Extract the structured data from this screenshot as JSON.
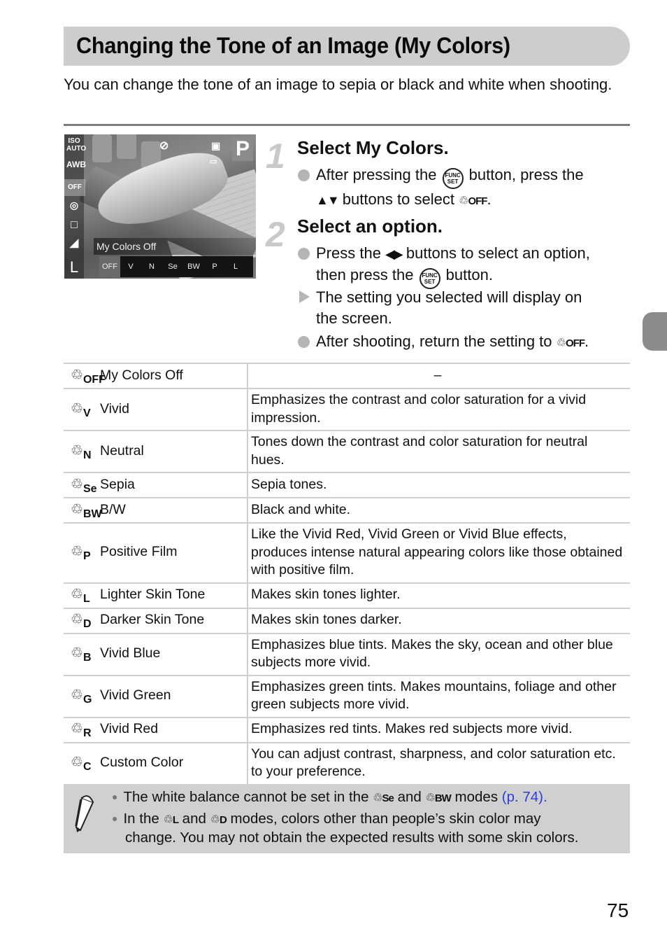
{
  "title": "Changing the Tone of an Image (My Colors)",
  "intro": "You can change the tone of an image to sepia or black and white when shooting.",
  "camera_screen": {
    "left_icons": [
      "ISO AUTO",
      "AWB",
      "OFF",
      "metering",
      "drive",
      "quality",
      "L"
    ],
    "mode": "P",
    "current_label": "My Colors Off",
    "options": [
      "OFF",
      "V",
      "N",
      "Se",
      "BW",
      "P",
      "L"
    ]
  },
  "steps": [
    {
      "number": "1",
      "title": "Select My Colors.",
      "items": [
        {
          "type": "bullet",
          "parts": [
            "After pressing the ",
            "button, press the",
            "buttons to select",
            "."
          ]
        }
      ]
    },
    {
      "number": "2",
      "title": "Select an option.",
      "items": [
        {
          "type": "bullet",
          "parts": [
            "Press the ",
            "buttons to select an option,",
            "then press the ",
            "button."
          ]
        },
        {
          "type": "result",
          "text_line1": "The setting you selected will display on",
          "text_line2": "the screen."
        },
        {
          "type": "bullet",
          "parts": [
            "After shooting, return the setting to ",
            "."
          ]
        }
      ]
    }
  ],
  "func_set_label": {
    "top": "FUNC",
    "bottom": "SET"
  },
  "my_colors_off_icon": "OFF",
  "table": {
    "rows": [
      {
        "icon": "OFF",
        "name": "My Colors Off",
        "description": "–"
      },
      {
        "icon": "V",
        "name": "Vivid",
        "description": "Emphasizes the contrast and color saturation for a vivid impression."
      },
      {
        "icon": "N",
        "name": "Neutral",
        "description": "Tones down the contrast and color saturation for neutral hues."
      },
      {
        "icon": "Se",
        "name": "Sepia",
        "description": "Sepia tones."
      },
      {
        "icon": "BW",
        "name": "B/W",
        "description": "Black and white."
      },
      {
        "icon": "P",
        "name": "Positive Film",
        "description": "Like the Vivid Red, Vivid Green or Vivid Blue effects, produces intense natural appearing colors like those obtained with positive film."
      },
      {
        "icon": "L",
        "name": "Lighter Skin Tone",
        "description": "Makes skin tones lighter."
      },
      {
        "icon": "D",
        "name": "Darker Skin Tone",
        "description": "Makes skin tones darker."
      },
      {
        "icon": "B",
        "name": "Vivid Blue",
        "description": "Emphasizes blue tints. Makes the sky, ocean and other blue subjects more vivid."
      },
      {
        "icon": "G",
        "name": "Vivid Green",
        "description": "Emphasizes green tints. Makes mountains, foliage and other green subjects more vivid."
      },
      {
        "icon": "R",
        "name": "Vivid Red",
        "description": "Emphasizes red tints. Makes red subjects more vivid."
      },
      {
        "icon": "C",
        "name": "Custom Color",
        "description": "You can adjust contrast, sharpness, and color saturation etc. to your preference."
      }
    ]
  },
  "note": {
    "line1": {
      "before": "The white balance cannot be set in the ",
      "icon1": "Se",
      "and": " and ",
      "icon2": "BW",
      "after": " modes ",
      "link": "(p. 74)."
    },
    "line2": {
      "before": "In the ",
      "icon1": "L",
      "and": " and ",
      "icon2": "D",
      "after": " modes, colors other than people’s skin color may"
    },
    "line3": "change. You may not obtain the expected results with some skin colors."
  },
  "page_number": "75",
  "colors": {
    "link": "#2b3fd6",
    "title_bar": "#cdcdcd",
    "note_bg": "#d0d0d0"
  }
}
